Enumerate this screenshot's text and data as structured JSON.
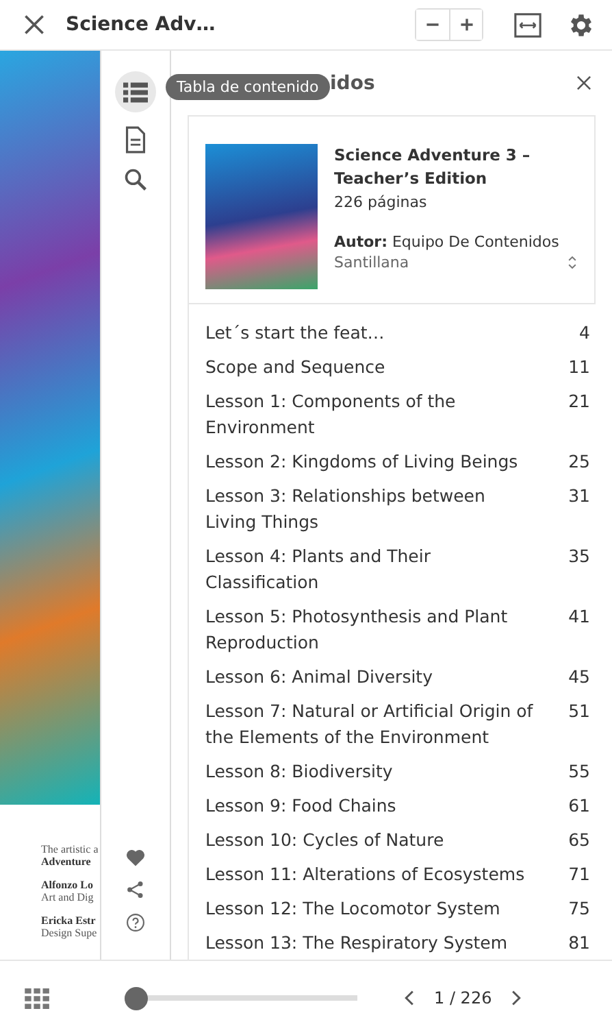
{
  "header": {
    "title": "Science Adv…"
  },
  "page_text": [
    "The artistic a",
    "Adventure",
    "Alfonzo Lo",
    "Art and Dig",
    "Ericka Estr",
    "Design Supe"
  ],
  "tooltip": "Tabla de contenido",
  "panel": {
    "title": "idos",
    "book": {
      "title": "Science Adventure 3 – Teacher’s Edition",
      "pages": "226 páginas",
      "author_label": "Autor:",
      "author": "Equipo De Contenidos",
      "publisher": "Santillana"
    },
    "toc": [
      {
        "title": "Let´s start the feat…",
        "page": "4"
      },
      {
        "title": "Scope and Sequence",
        "page": "11"
      },
      {
        "title": "Lesson 1: Components of the Environment",
        "page": "21"
      },
      {
        "title": "Lesson 2: Kingdoms of Living Beings",
        "page": "25"
      },
      {
        "title": "Lesson 3: Relationships between Living Things",
        "page": "31"
      },
      {
        "title": "Lesson 4: Plants and Their Classification",
        "page": "35"
      },
      {
        "title": "Lesson 5: Photosynthesis and Plant Reproduction",
        "page": "41"
      },
      {
        "title": "Lesson 6: Animal Diversity",
        "page": "45"
      },
      {
        "title": "Lesson 7: Natural or Artificial Origin of the Elements of the Environment",
        "page": "51"
      },
      {
        "title": "Lesson 8: Biodiversity",
        "page": "55"
      },
      {
        "title": "Lesson 9: Food Chains",
        "page": "61"
      },
      {
        "title": "Lesson 10: Cycles of Nature",
        "page": "65"
      },
      {
        "title": "Lesson 11: Alterations of Ecosystems",
        "page": "71"
      },
      {
        "title": "Lesson 12: The Locomotor System",
        "page": "75"
      },
      {
        "title": "Lesson 13: The Respiratory System",
        "page": "81"
      }
    ]
  },
  "footer": {
    "slider": {
      "level": 0
    },
    "page_indicator": "1 / 226"
  }
}
